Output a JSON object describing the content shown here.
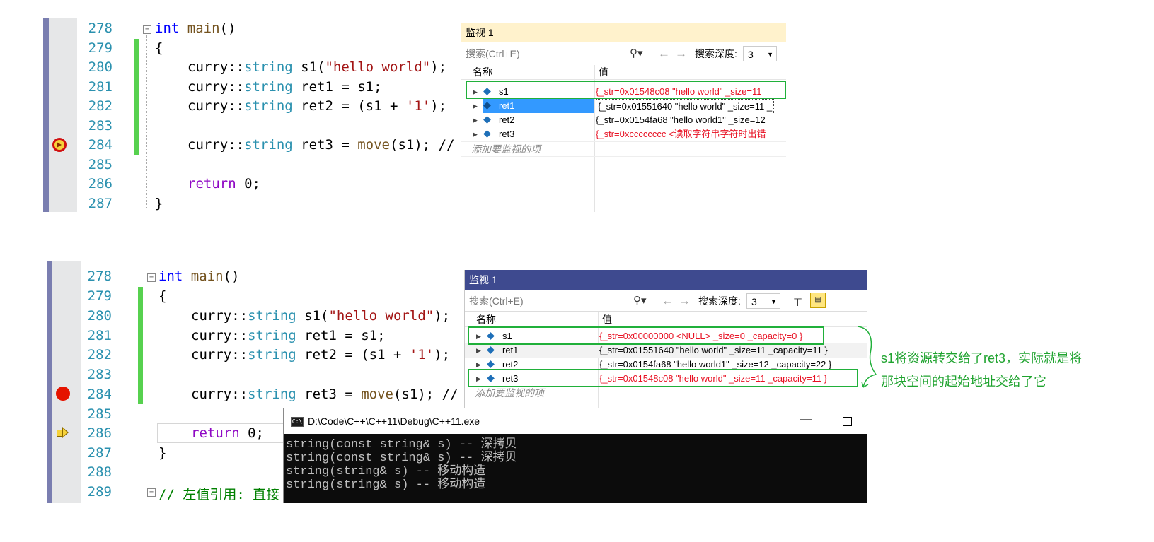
{
  "colors": {
    "accent_green": "#20b03a",
    "error_red": "#e81123",
    "keyword": "#0000ff",
    "type": "#2b91af",
    "string": "#a31515"
  },
  "top": {
    "line_numbers": [
      "278",
      "279",
      "280",
      "281",
      "282",
      "283",
      "284",
      "285",
      "286",
      "287"
    ],
    "code": {
      "kw_int": "int",
      "fn_main": "main",
      "paren": "()",
      "brace_open": "{",
      "ns": "curry::",
      "ty_string": "string",
      "l280_rest1": " s1(",
      "l280_str": "\"hello world\"",
      "l280_rest2": ");",
      "l281_rest": " ret1 = s1;",
      "l282_rest1": " ret2 = (s1 + ",
      "l282_str": "'1'",
      "l282_rest2": ");",
      "l284_rest1": " ret3 = ",
      "l284_fn": "move",
      "l284_rest2": "(s1); //",
      "kw_return": "return",
      "ret_rest": " 0;",
      "brace_close": "}"
    },
    "watch": {
      "title": "监视 1",
      "search_placeholder": "搜索(Ctrl+E)",
      "search_icon": "search-icon",
      "depth_label": "搜索深度:",
      "depth_value": "3",
      "col_name": "名称",
      "col_value": "值",
      "rows": [
        {
          "name": "s1",
          "value": "{_str=0x01548c08 \"hello world\" _size=11"
        },
        {
          "name": "ret1",
          "value": "{_str=0x01551640 \"hello world\" _size=11 _"
        },
        {
          "name": "ret2",
          "value": "{_str=0x0154fa68 \"hello world1\" _size=12"
        },
        {
          "name": "ret3",
          "value": "{_str=0xcccccccc <读取字符串字符时出错"
        }
      ],
      "add_item": "添加要监视的项"
    }
  },
  "bottom": {
    "line_numbers": [
      "278",
      "279",
      "280",
      "281",
      "282",
      "283",
      "284",
      "285",
      "286",
      "287",
      "288",
      "289"
    ],
    "code": {
      "l289_comment": "// 左值引用: 直接"
    },
    "watch": {
      "title": "监视 1",
      "search_placeholder": "搜索(Ctrl+E)",
      "depth_label": "搜索深度:",
      "depth_value": "3",
      "col_name": "名称",
      "col_value": "值",
      "rows": [
        {
          "name": "s1",
          "value": "{_str=0x00000000 <NULL> _size=0 _capacity=0 }"
        },
        {
          "name": "ret1",
          "value": "{_str=0x01551640 \"hello world\" _size=11 _capacity=11 }"
        },
        {
          "name": "ret2",
          "value": "{_str=0x0154fa68 \"hello world1\" _size=12 _capacity=22 }"
        },
        {
          "name": "ret3",
          "value": "{_str=0x01548c08 \"hello world\" _size=11 _capacity=11 }"
        }
      ],
      "add_item": "添加要监视的项"
    },
    "console": {
      "title": "D:\\Code\\C++\\C++11\\Debug\\C++11.exe",
      "lines": [
        "string(const string& s) -- 深拷贝",
        "string(const string& s) -- 深拷贝",
        "string(string& s) -- 移动构造",
        "string(string& s) -- 移动构造"
      ]
    },
    "annotation": {
      "line1": "s1将资源转交给了ret3，实际就是将",
      "line2": "那块空间的起始地址交给了它"
    }
  }
}
